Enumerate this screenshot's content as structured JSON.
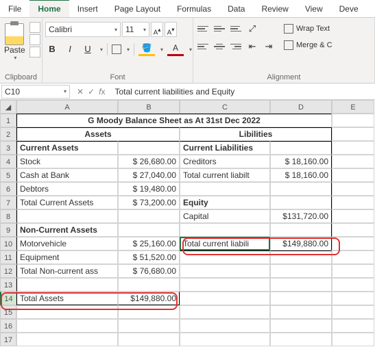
{
  "tabs": {
    "file": "File",
    "home": "Home",
    "insert": "Insert",
    "pagelayout": "Page Layout",
    "formulas": "Formulas",
    "data": "Data",
    "review": "Review",
    "view": "View",
    "developer": "Deve"
  },
  "ribbon": {
    "paste": "Paste",
    "clipboard": "Clipboard",
    "font_name": "Calibri",
    "font_size": "11",
    "font_group": "Font",
    "wrap": "Wrap Text",
    "merge": "Merge & C",
    "align_group": "Alignment"
  },
  "namebox": "C10",
  "formula": "Total current liabilities and Equity",
  "cols": {
    "A": "A",
    "B": "B",
    "C": "C",
    "D": "D",
    "E": "E"
  },
  "rows": [
    "1",
    "2",
    "3",
    "4",
    "5",
    "6",
    "7",
    "8",
    "9",
    "10",
    "11",
    "12",
    "13",
    "14",
    "15",
    "16",
    "17"
  ],
  "sheet": {
    "title": "G Moody Balance Sheet as At 31st Dec 2022",
    "assets_hdr": "Assets",
    "liab_hdr": "Libilities",
    "current_assets": "Current Assets",
    "stock": "Stock",
    "stock_v": "$  26,680.00",
    "cash": "Cash at Bank",
    "cash_v": "$  27,040.00",
    "debtors": "Debtors",
    "debtors_v": "$  19,480.00",
    "tca": "Total Current Assets",
    "tca_v": "$  73,200.00",
    "nca_hdr": "Non-Current Assets",
    "motor": "Motorvehicle",
    "motor_v": "$  25,160.00",
    "equip": "Equipment",
    "equip_v": "$  51,520.00",
    "tnca": "Total Non-current ass",
    "tnca_v": "$  76,680.00",
    "total_assets": "Total Assets",
    "total_assets_v": "$149,880.00",
    "current_liab": "Current Liabilities",
    "creditors": "Creditors",
    "creditors_v": "$  18,160.00",
    "tcl": "Total current liabilt",
    "tcl_v": "$  18,160.00",
    "equity": "Equity",
    "capital": "Capital",
    "capital_v": "$131,720.00",
    "tcle": "Total current liabili",
    "tcle_v": "$149,880.00"
  }
}
